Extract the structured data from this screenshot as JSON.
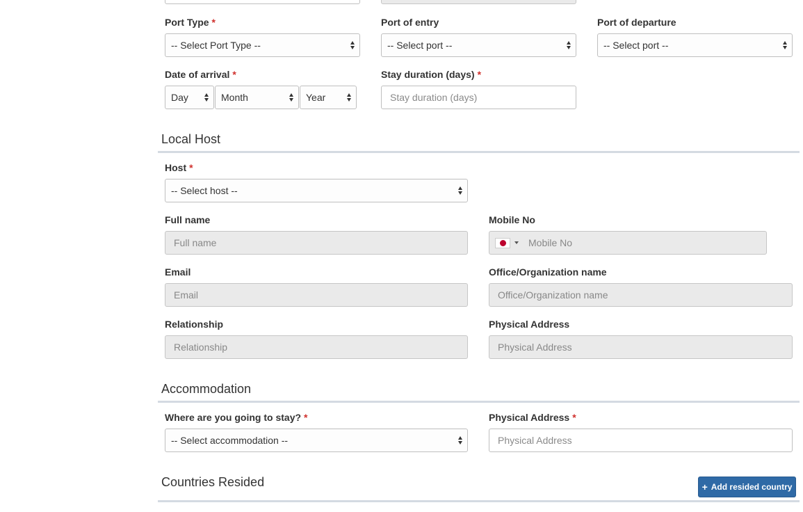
{
  "travel": {
    "port_type": {
      "label": "Port Type",
      "required_mark": "*",
      "value": "-- Select Port Type --"
    },
    "port_of_entry": {
      "label": "Port of entry",
      "value": "-- Select port --"
    },
    "port_of_departure": {
      "label": "Port of departure",
      "value": "-- Select port --"
    },
    "date_of_arrival": {
      "label": "Date of arrival",
      "required_mark": "*",
      "day": "Day",
      "month": "Month",
      "year": "Year"
    },
    "stay_duration": {
      "label": "Stay duration (days)",
      "required_mark": "*",
      "placeholder": "Stay duration (days)"
    }
  },
  "local_host": {
    "title": "Local Host",
    "host": {
      "label": "Host",
      "required_mark": "*",
      "value": "-- Select host --"
    },
    "full_name": {
      "label": "Full name",
      "placeholder": "Full name"
    },
    "mobile_no": {
      "label": "Mobile No",
      "placeholder": "Mobile No",
      "flag_icon": "japan-flag-icon"
    },
    "email": {
      "label": "Email",
      "placeholder": "Email"
    },
    "office": {
      "label": "Office/Organization name",
      "placeholder": "Office/Organization name"
    },
    "relationship": {
      "label": "Relationship",
      "placeholder": "Relationship"
    },
    "physical_address": {
      "label": "Physical Address",
      "placeholder": "Physical Address"
    }
  },
  "accommodation": {
    "title": "Accommodation",
    "stay": {
      "label": "Where are you going to stay?",
      "required_mark": "*",
      "value": "-- Select accommodation --"
    },
    "physical_address": {
      "label": "Physical Address",
      "required_mark": "*",
      "placeholder": "Physical Address"
    }
  },
  "countries_resided": {
    "title": "Countries Resided",
    "add_button": "Add resided country"
  },
  "colors": {
    "primary": "#2f6aa6",
    "required": "#d0312d",
    "rule": "#d4dae2",
    "disabled": "#eaeaea"
  }
}
